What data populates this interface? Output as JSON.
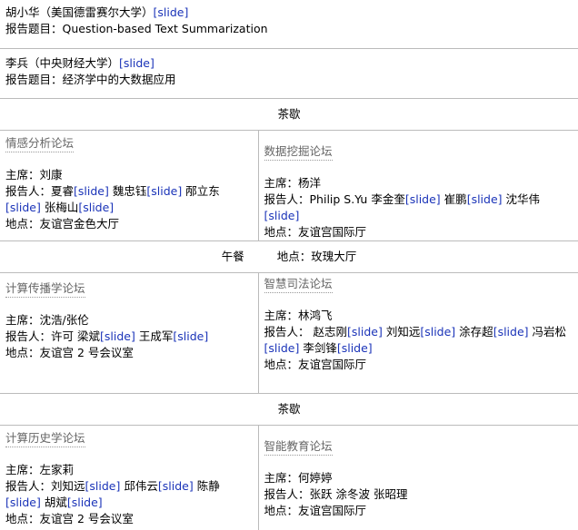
{
  "talks": [
    {
      "speaker": "胡小华（美国德雷赛尔大学）",
      "slide": "[slide]",
      "topic": "报告题目：Question-based Text Summarization"
    },
    {
      "speaker": "李兵（中央财经大学）",
      "slide": "[slide]",
      "topic": "报告题目：经济学中的大数据应用"
    }
  ],
  "breaks": {
    "tea1": "茶歇",
    "lunch": "午餐",
    "lunch_location": "地点：玫瑰大厅",
    "tea2": "茶歇"
  },
  "forums": {
    "sentiment": {
      "title": "情感分析论坛",
      "chair": "主席：刘康",
      "reporters_label": "报告人：",
      "reporters": [
        "夏睿",
        "魏忠钰",
        "邴立东",
        "张梅山"
      ],
      "location": "地点：友谊宫金色大厅"
    },
    "datamining": {
      "title": "数据挖掘论坛",
      "chair": "主席：杨洋",
      "reporters_label": "报告人：",
      "reporters": [
        "Philip S.Yu",
        "李金奎",
        "崔鹏",
        "沈华伟"
      ],
      "location": "地点：友谊宫国际厅"
    },
    "computational_comm": {
      "title": "计算传播学论坛",
      "chair": "主席：沈浩/张伦",
      "reporters_label": "报告人：",
      "reporters": [
        "许可",
        "梁斌",
        "王成军"
      ],
      "location": "地点：友谊宫 2 号会议室"
    },
    "judicial": {
      "title": "智慧司法论坛",
      "chair": "主席：林鸿飞",
      "reporters_label": "报告人： ",
      "reporters": [
        "赵志刚",
        "刘知远",
        "涂存超",
        "冯岩松",
        "李剑锋"
      ],
      "location": "地点：友谊宫国际厅"
    },
    "history": {
      "title": "计算历史学论坛",
      "chair": "主席：左家莉",
      "reporters_label": "报告人：",
      "reporters": [
        "刘知远",
        "邱伟云",
        "陈静",
        "胡斌"
      ],
      "location": "地点：友谊宫 2 号会议室"
    },
    "education": {
      "title": "智能教育论坛",
      "chair": "主席：何婷婷",
      "reporters_label": "报告人：",
      "reporters": [
        "张跃",
        "涂冬波",
        "张昭理"
      ],
      "location": "地点：友谊宫国际厅"
    }
  },
  "slide_label": "[slide]",
  "link_color": "#1a33b8"
}
